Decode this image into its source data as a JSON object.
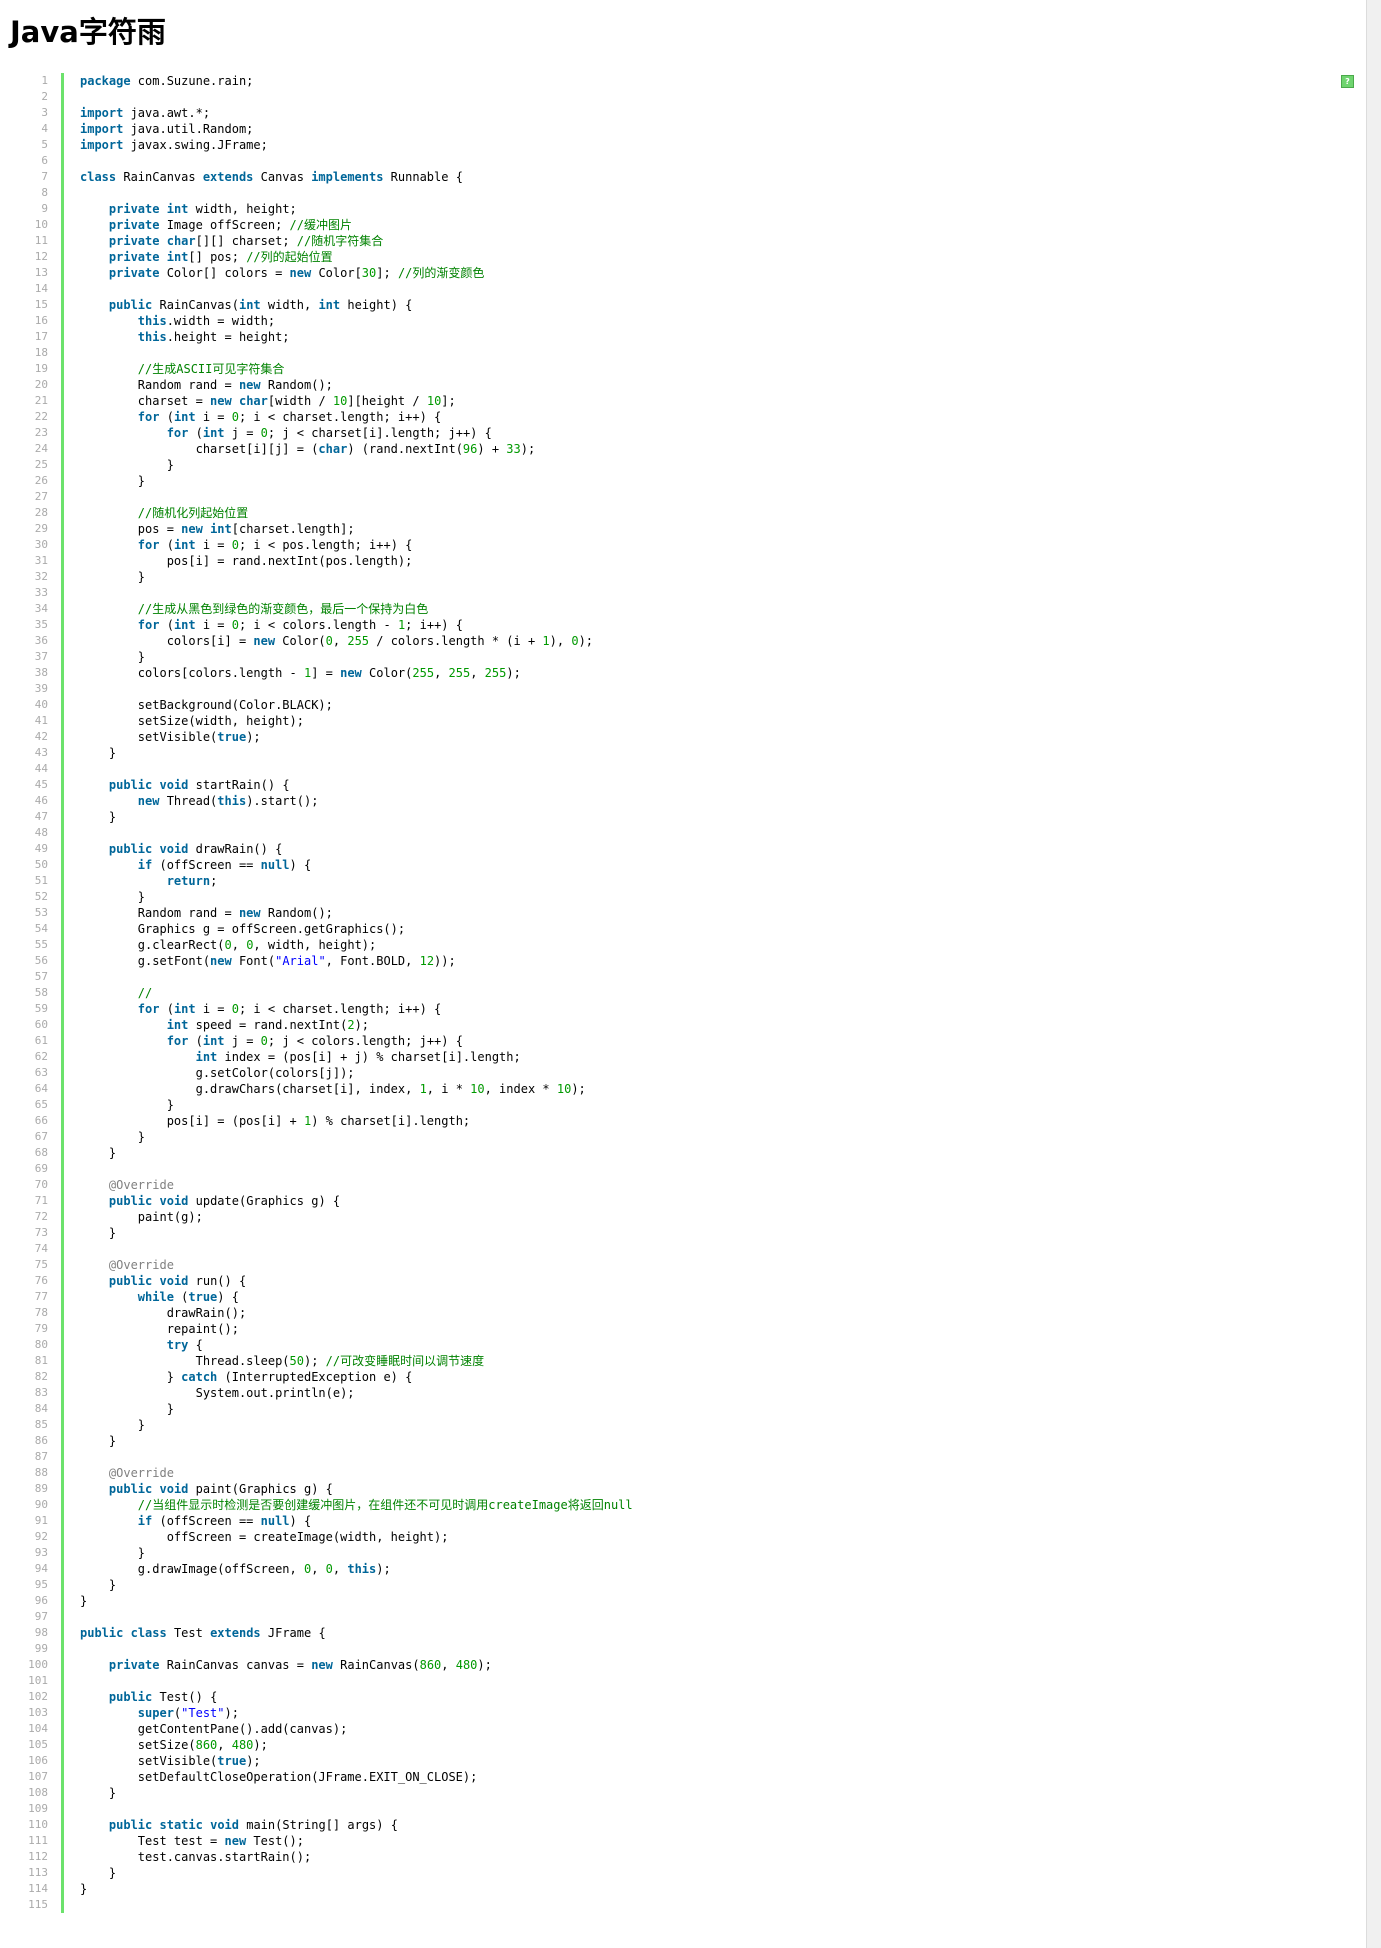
{
  "page": {
    "title": "Java字符雨"
  },
  "toolbar": {
    "help_label": "?"
  },
  "code": {
    "language": "java",
    "lines": [
      "package com.Suzune.rain;",
      "",
      "import java.awt.*;",
      "import java.util.Random;",
      "import javax.swing.JFrame;",
      "",
      "class RainCanvas extends Canvas implements Runnable {",
      "",
      "    private int width, height;",
      "    private Image offScreen; //缓冲图片",
      "    private char[][] charset; //随机字符集合",
      "    private int[] pos; //列的起始位置",
      "    private Color[] colors = new Color[30]; //列的渐变颜色",
      "",
      "    public RainCanvas(int width, int height) {",
      "        this.width = width;",
      "        this.height = height;",
      "",
      "        //生成ASCII可见字符集合",
      "        Random rand = new Random();",
      "        charset = new char[width / 10][height / 10];",
      "        for (int i = 0; i < charset.length; i++) {",
      "            for (int j = 0; j < charset[i].length; j++) {",
      "                charset[i][j] = (char) (rand.nextInt(96) + 33);",
      "            }",
      "        }",
      "",
      "        //随机化列起始位置",
      "        pos = new int[charset.length];",
      "        for (int i = 0; i < pos.length; i++) {",
      "            pos[i] = rand.nextInt(pos.length);",
      "        }",
      "",
      "        //生成从黑色到绿色的渐变颜色，最后一个保持为白色",
      "        for (int i = 0; i < colors.length - 1; i++) {",
      "            colors[i] = new Color(0, 255 / colors.length * (i + 1), 0);",
      "        }",
      "        colors[colors.length - 1] = new Color(255, 255, 255);",
      "",
      "        setBackground(Color.BLACK);",
      "        setSize(width, height);",
      "        setVisible(true);",
      "    }",
      "",
      "    public void startRain() {",
      "        new Thread(this).start();",
      "    }",
      "",
      "    public void drawRain() {",
      "        if (offScreen == null) {",
      "            return;",
      "        }",
      "        Random rand = new Random();",
      "        Graphics g = offScreen.getGraphics();",
      "        g.clearRect(0, 0, width, height);",
      "        g.setFont(new Font(\"Arial\", Font.BOLD, 12));",
      "",
      "        //",
      "        for (int i = 0; i < charset.length; i++) {",
      "            int speed = rand.nextInt(2);",
      "            for (int j = 0; j < colors.length; j++) {",
      "                int index = (pos[i] + j) % charset[i].length;",
      "                g.setColor(colors[j]);",
      "                g.drawChars(charset[i], index, 1, i * 10, index * 10);",
      "            }",
      "            pos[i] = (pos[i] + 1) % charset[i].length;",
      "        }",
      "    }",
      "",
      "    @Override",
      "    public void update(Graphics g) {",
      "        paint(g);",
      "    }",
      "",
      "    @Override",
      "    public void run() {",
      "        while (true) {",
      "            drawRain();",
      "            repaint();",
      "            try {",
      "                Thread.sleep(50); //可改变睡眠时间以调节速度",
      "            } catch (InterruptedException e) {",
      "                System.out.println(e);",
      "            }",
      "        }",
      "    }",
      "",
      "    @Override",
      "    public void paint(Graphics g) {",
      "        //当组件显示时检测是否要创建缓冲图片，在组件还不可见时调用createImage将返回null",
      "        if (offScreen == null) {",
      "            offScreen = createImage(width, height);",
      "        }",
      "        g.drawImage(offScreen, 0, 0, this);",
      "    }",
      "}",
      "",
      "public class Test extends JFrame {",
      "",
      "    private RainCanvas canvas = new RainCanvas(860, 480);",
      "",
      "    public Test() {",
      "        super(\"Test\");",
      "        getContentPane().add(canvas);",
      "        setSize(860, 480);",
      "        setVisible(true);",
      "        setDefaultCloseOperation(JFrame.EXIT_ON_CLOSE);",
      "    }",
      "",
      "    public static void main(String[] args) {",
      "        Test test = new Test();",
      "        test.canvas.startRain();",
      "    }",
      "}",
      ""
    ]
  },
  "colors": {
    "keyword": "#006699",
    "comment": "#008200",
    "number": "#009900",
    "string": "#0000ff",
    "annotation": "#808080",
    "gutter_bar": "#6ce26c",
    "line_number": "#aaaaaa"
  }
}
